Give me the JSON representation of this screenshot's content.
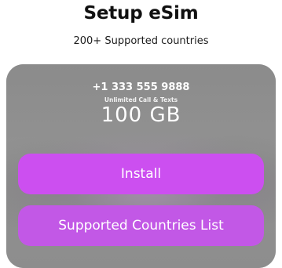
{
  "header": {
    "title": "Setup eSim",
    "subtitle": "200+ Supported countries"
  },
  "plan": {
    "phone_number": "+1 333 555 9888",
    "description": "Unlimited Call & Texts",
    "data_amount": "100 GB"
  },
  "actions": {
    "install_label": "Install",
    "countries_label": "Supported Countries List"
  },
  "colors": {
    "button_accent": "#cc4ff0",
    "card_background": "#8e8e8e",
    "title_text": "#111111"
  }
}
